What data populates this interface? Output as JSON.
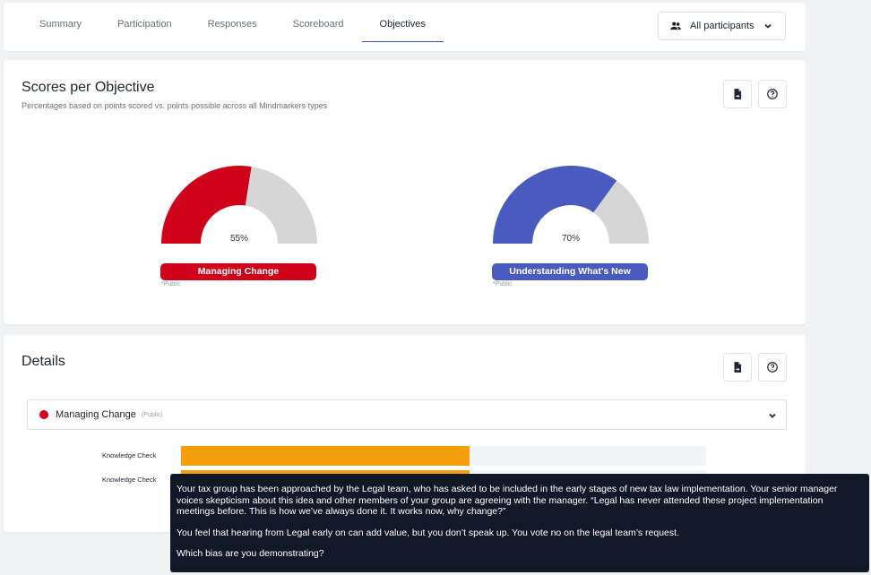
{
  "tabs": [
    {
      "label": "Summary",
      "active": false
    },
    {
      "label": "Participation",
      "active": false
    },
    {
      "label": "Responses",
      "active": false
    },
    {
      "label": "Scoreboard",
      "active": false
    },
    {
      "label": "Objectives",
      "active": true
    }
  ],
  "filter": {
    "label": "All participants",
    "icon": "people-icon"
  },
  "scores": {
    "title": "Scores per Objective",
    "subtitle": "Percentages based on points scored vs. points possible across all Mindmarkers types",
    "gauges": [
      {
        "name": "Managing Change",
        "percent": 55,
        "percent_label": "55%",
        "color": "#d0021b",
        "track": "#d6d6d6",
        "note": "*Public"
      },
      {
        "name": "Understanding What's New",
        "percent": 70,
        "percent_label": "70%",
        "color": "#4a5bbf",
        "track": "#d6d6d6",
        "note": "*Public"
      }
    ]
  },
  "details": {
    "title": "Details",
    "accordion": {
      "label": "Managing Change",
      "tag": "(Public)",
      "color": "#d0021b"
    },
    "bars": [
      {
        "label": "Knowledge Check",
        "fraction": 0.55,
        "color": "#f59e0b"
      },
      {
        "label": "Knowledge Check",
        "fraction": 0.55,
        "color": "#f59e0b"
      }
    ]
  },
  "tooltip": {
    "p1": "Your tax group has been approached by the Legal team, who has asked to be included in the early stages of new tax law implementation. Your senior manager voices skepticism about this idea and other members of your group are agreeing with the manager. “Legal has never attended these project implementation meetings before. This is how we’ve always done it. It works now, why change?”",
    "p2": "You feel that hearing from Legal early on can add value, but you don’t speak up. You vote no on the legal team’s request.",
    "p3": "Which bias are you demonstrating?"
  },
  "icons": {
    "export": "file-export-icon",
    "help": "help-circle-icon",
    "chevron": "chevron-down-icon"
  }
}
